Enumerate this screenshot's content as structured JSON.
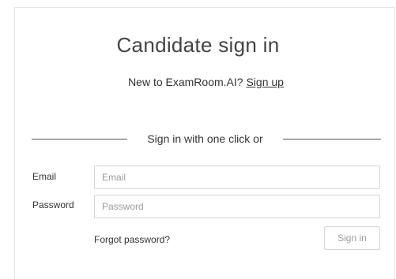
{
  "header": {
    "title": "Candidate sign in",
    "subtitle_text": "New to ExamRoom.AI?",
    "signup_link": "Sign up"
  },
  "divider": {
    "text": "Sign in with one click or"
  },
  "form": {
    "email_label": "Email",
    "email_placeholder": "Email",
    "email_value": "",
    "password_label": "Password",
    "password_placeholder": "Password",
    "password_value": "",
    "forgot_link": "Forgot password?",
    "submit_label": "Sign in"
  }
}
